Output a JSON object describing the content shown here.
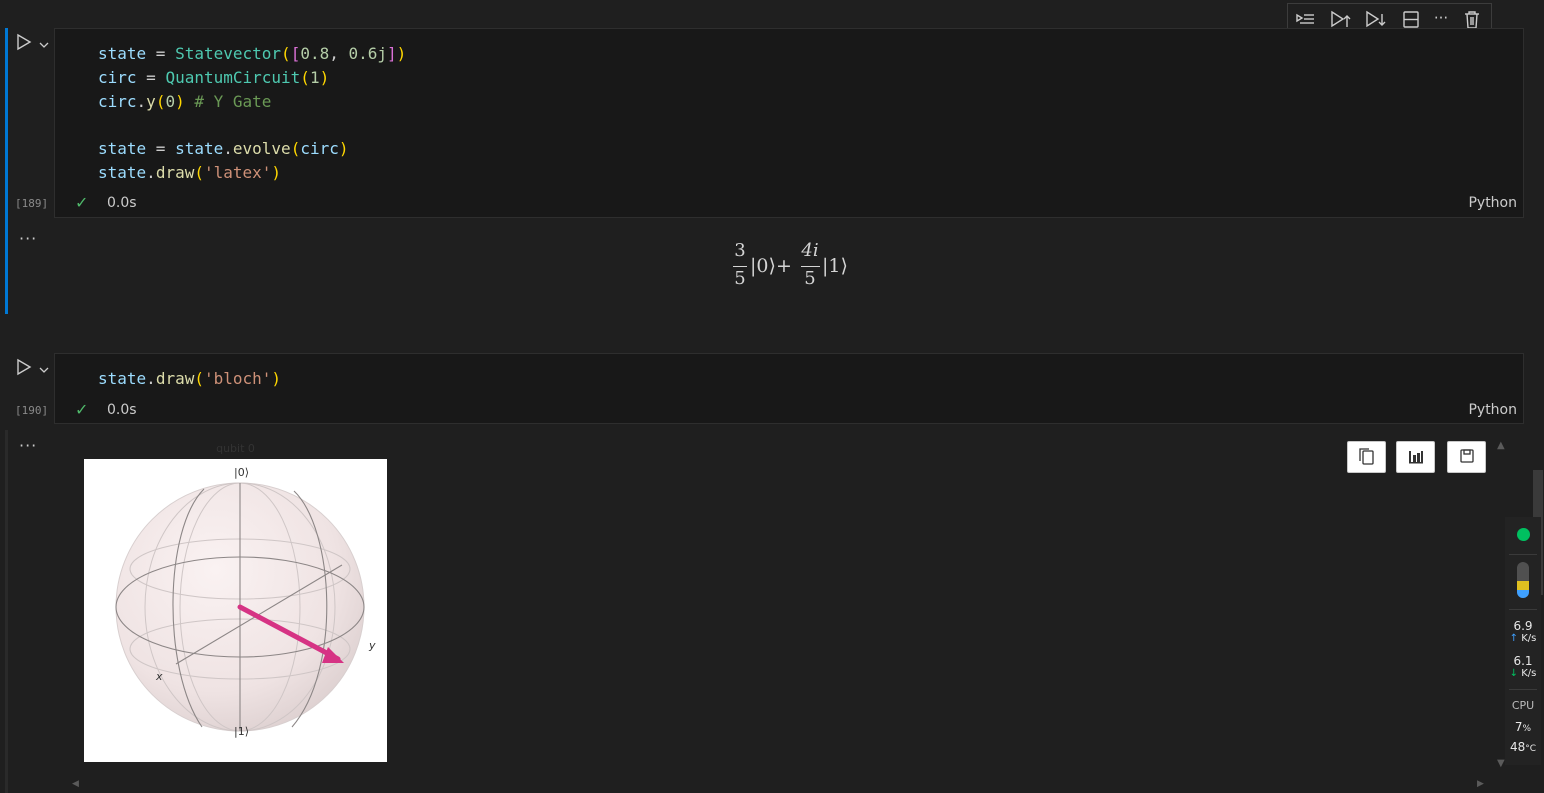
{
  "toolbar": {
    "buttons": [
      {
        "name": "execute-above-icon"
      },
      {
        "name": "execute-cell-and-below-icon"
      },
      {
        "name": "execute-below-icon"
      },
      {
        "name": "split-cell-icon"
      },
      {
        "name": "more-icon"
      },
      {
        "name": "delete-icon"
      }
    ]
  },
  "cell1": {
    "exec_count": "[189]",
    "status_time": "0.0s",
    "language": "Python",
    "code": {
      "l1_var": "state",
      "l1_eq": " = ",
      "l1_cls": "Statevector",
      "l1_p1": "(",
      "l1_b1": "[",
      "l1_n1": "0.8",
      "l1_comma": ", ",
      "l1_n2": "0.6j",
      "l1_b2": "]",
      "l1_p2": ")",
      "l2_var": "circ",
      "l2_eq": " = ",
      "l2_cls": "QuantumCircuit",
      "l2_p1": "(",
      "l2_n": "1",
      "l2_p2": ")",
      "l3_var": "circ",
      "l3_dot": ".",
      "l3_fn": "y",
      "l3_p1": "(",
      "l3_n": "0",
      "l3_p2": ")",
      "l3_cmt": " # Y Gate",
      "l5_var": "state",
      "l5_eq": " = ",
      "l5_var2": "state",
      "l5_dot": ".",
      "l5_fn": "evolve",
      "l5_p1": "(",
      "l5_arg": "circ",
      "l5_p2": ")",
      "l6_var": "state",
      "l6_dot": ".",
      "l6_fn": "draw",
      "l6_p1": "(",
      "l6_str": "'latex'",
      "l6_p2": ")"
    },
    "output": {
      "more": "···",
      "latex": {
        "frac1_num": "3",
        "frac1_den": "5",
        "ket0": "|0⟩",
        "plus": "+",
        "frac2_num": "4i",
        "frac2_den": "5",
        "ket1": "|1⟩"
      }
    }
  },
  "cell2": {
    "exec_count": "[190]",
    "status_time": "0.0s",
    "language": "Python",
    "code": {
      "l1_var": "state",
      "l1_dot": ".",
      "l1_fn": "draw",
      "l1_p1": "(",
      "l1_str": "'bloch'",
      "l1_p2": ")"
    },
    "output": {
      "more": "···",
      "figure_title": "qubit 0",
      "label_top": "|0⟩",
      "label_bottom": "|1⟩",
      "label_x": "x",
      "label_y": "y",
      "arrow_color": "#d63384"
    }
  },
  "output_actions": [
    {
      "name": "copy-output-icon"
    },
    {
      "name": "open-in-data-viewer-icon"
    },
    {
      "name": "save-output-icon"
    }
  ],
  "system_widget": {
    "status_dot_color": "#00c060",
    "upload_value": "6.9",
    "upload_unit": "K/s",
    "download_value": "6.1",
    "download_unit": "K/s",
    "cpu_label": "CPU",
    "cpu_value": "7",
    "cpu_unit": "%",
    "temp_value": "48",
    "temp_unit": "°C"
  }
}
